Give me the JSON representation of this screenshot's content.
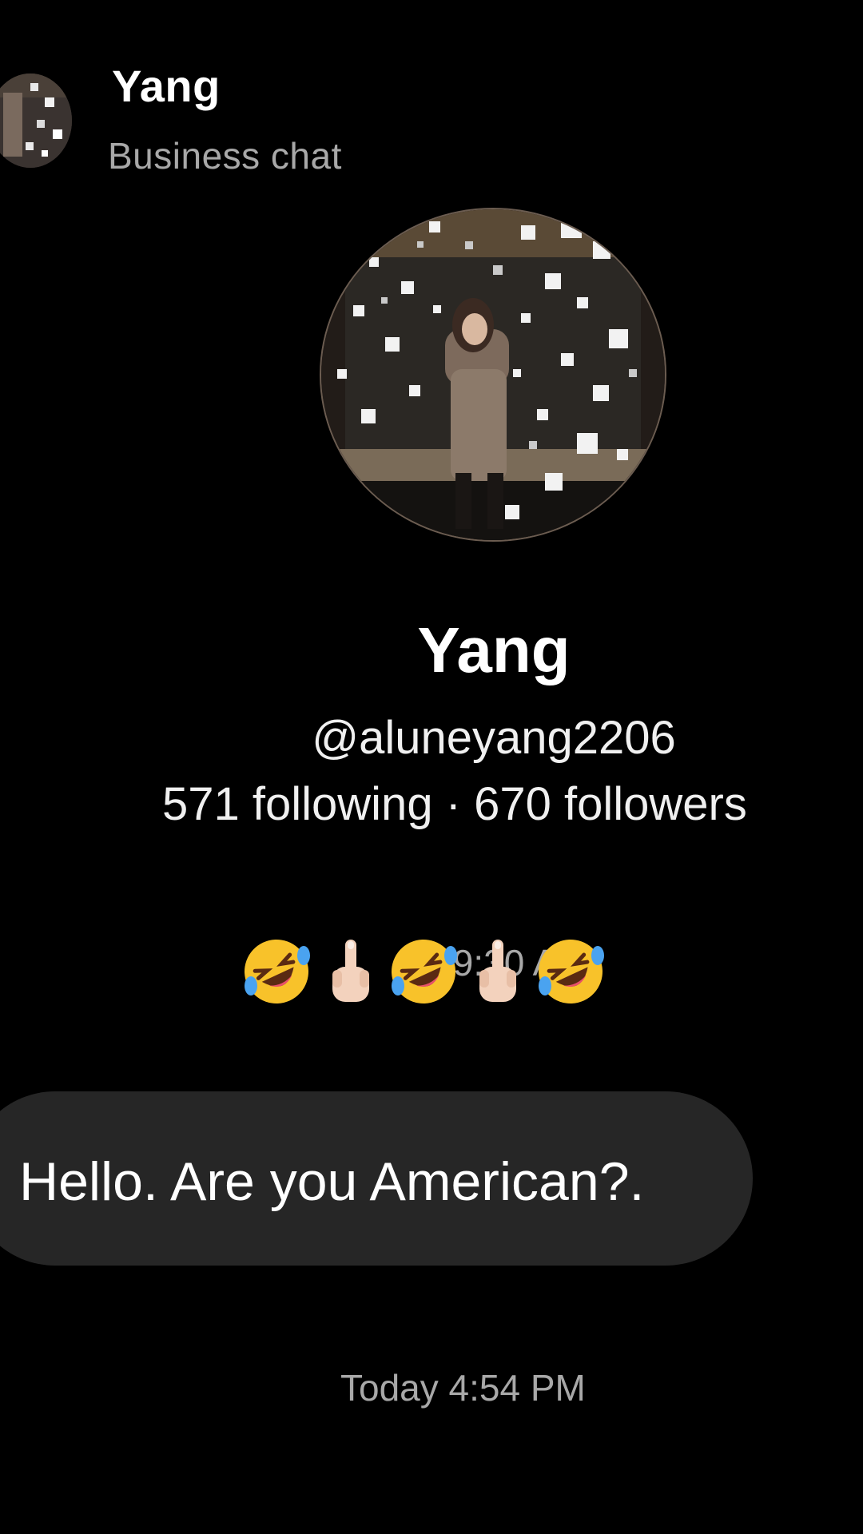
{
  "header": {
    "name": "Yang",
    "subtitle": "Business chat"
  },
  "profile": {
    "name": "Yang",
    "handle": "@aluneyang2206",
    "stats": "571 following · 670 followers"
  },
  "messages": [
    {
      "timestamp": "Fri 9:30 AM",
      "emoji_overlay": [
        "rolling-on-floor-laughing-icon",
        "middle-finger-icon",
        "rolling-on-floor-laughing-icon",
        "middle-finger-icon",
        "rolling-on-floor-laughing-icon"
      ]
    },
    {
      "text": "Hello. Are you American?."
    }
  ],
  "timestamp_bottom": "Today 4:54 PM",
  "colors": {
    "background": "#000000",
    "bubble": "#262626",
    "secondary_text": "#a8a8a8",
    "primary_text": "#ffffff"
  }
}
